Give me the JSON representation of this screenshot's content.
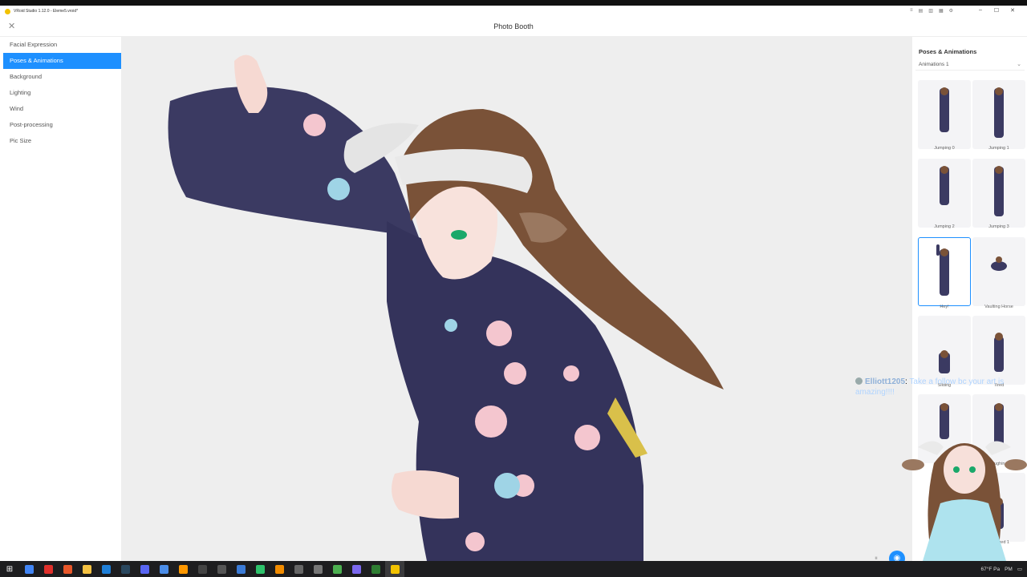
{
  "window": {
    "title": "VRoid Studio 1.12.0 - Eleme5.vroid*",
    "controls": [
      "–",
      "☐",
      "✕"
    ],
    "mini_icons": [
      "≡",
      "▤",
      "▥",
      "▦",
      "⚙"
    ]
  },
  "header": {
    "close_glyph": "✕",
    "title": "Photo Booth"
  },
  "left_nav": {
    "items": [
      {
        "label": "Facial Expression",
        "active": false
      },
      {
        "label": "Poses & Animations",
        "active": true
      },
      {
        "label": "Background",
        "active": false
      },
      {
        "label": "Lighting",
        "active": false
      },
      {
        "label": "Wind",
        "active": false
      },
      {
        "label": "Post-processing",
        "active": false
      },
      {
        "label": "Pic Size",
        "active": false
      }
    ]
  },
  "right_panel": {
    "title": "Poses & Animations",
    "dropdown": {
      "selected": "Animations 1",
      "chevron": "⌄"
    },
    "animations": [
      {
        "label": "Jumping 0",
        "selected": false
      },
      {
        "label": "Jumping 1",
        "selected": false
      },
      {
        "label": "Jumping 2",
        "selected": false
      },
      {
        "label": "Jumping 3",
        "selected": false
      },
      {
        "label": "Hey!",
        "selected": true
      },
      {
        "label": "Vaulting Horse",
        "selected": false
      },
      {
        "label": "Sliding",
        "selected": false
      },
      {
        "label": "Tired",
        "selected": false
      },
      {
        "label": "",
        "selected": false
      },
      {
        "label": "...ughing",
        "selected": false
      },
      {
        "label": "",
        "selected": false
      },
      {
        "label": "...maged 1",
        "selected": false
      }
    ]
  },
  "chat_overlay": {
    "username": "Elliott1205",
    "message": "Take a follow bc your art is amazing!!!!"
  },
  "viewport_controls": {
    "pause_glyph": "⏸",
    "camera_glyph": "◉"
  },
  "taskbar": {
    "start_glyph": "⊞",
    "apps": [
      {
        "name": "chrome",
        "color": "#4285f4"
      },
      {
        "name": "opera",
        "color": "#e0302b"
      },
      {
        "name": "ms-office",
        "color": "#e8572a"
      },
      {
        "name": "file-explorer",
        "color": "#f5c242"
      },
      {
        "name": "edge",
        "color": "#1f7fd8"
      },
      {
        "name": "steam",
        "color": "#2a475e"
      },
      {
        "name": "discord",
        "color": "#5865f2"
      },
      {
        "name": "photos",
        "color": "#4b8de8"
      },
      {
        "name": "music-app",
        "color": "#ff9800"
      },
      {
        "name": "obs",
        "color": "#444444"
      },
      {
        "name": "media-app",
        "color": "#555555"
      },
      {
        "name": "vroid",
        "color": "#3b7bd6"
      },
      {
        "name": "marker-app",
        "color": "#2ec26b"
      },
      {
        "name": "vlc",
        "color": "#f28c00"
      },
      {
        "name": "recorder",
        "color": "#666666"
      },
      {
        "name": "tool-app",
        "color": "#777777"
      },
      {
        "name": "paint-app",
        "color": "#4caf50"
      },
      {
        "name": "settings-app",
        "color": "#7b68ee"
      },
      {
        "name": "terminal",
        "color": "#2e7d32"
      },
      {
        "name": "vroid-studio",
        "color": "#f2c200"
      }
    ],
    "tray": {
      "weather": "67°F Pa",
      "clock": "PM"
    }
  }
}
